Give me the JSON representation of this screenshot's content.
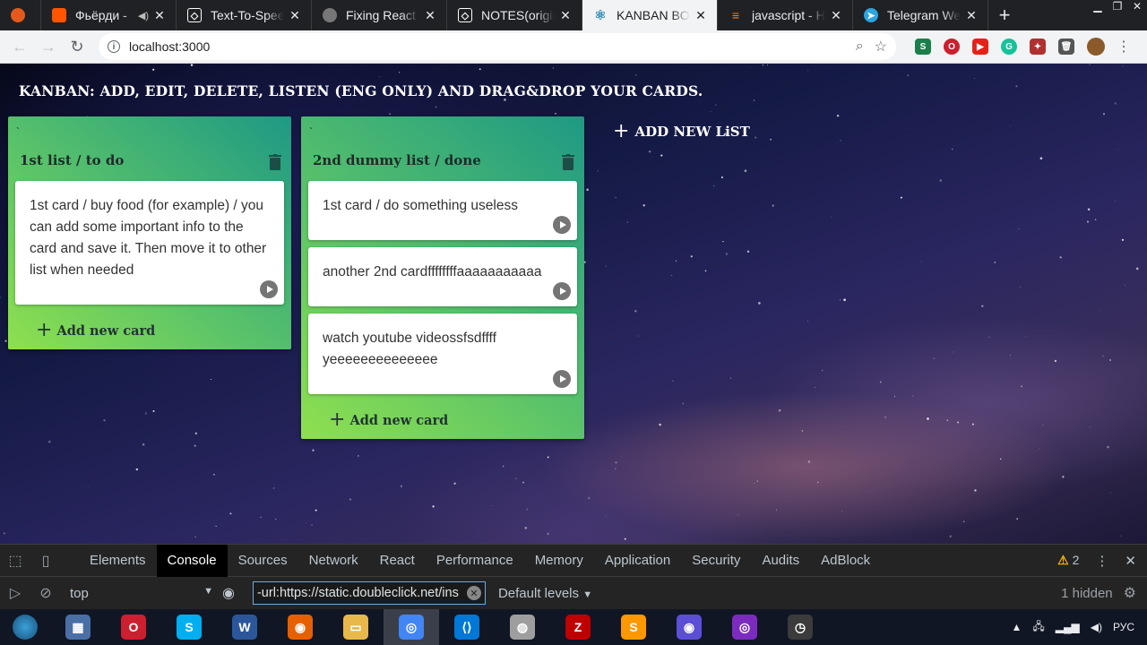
{
  "browser": {
    "tabs": [
      {
        "title": "",
        "icon": "firefox-icon",
        "color": "#e55a1c"
      },
      {
        "title": "Фьёрди - ",
        "icon": "soundcloud-icon",
        "color": "#ff5500",
        "audio": "speaker-icon"
      },
      {
        "title": "Text-To-Speec",
        "icon": "codepen-icon",
        "color": "#444444"
      },
      {
        "title": "Fixing React W",
        "icon": "globe-icon",
        "color": "#777777"
      },
      {
        "title": "NOTES(origina",
        "icon": "codepen-icon",
        "color": "#444444"
      },
      {
        "title": "KANBAN BOA",
        "icon": "react-icon",
        "color": "#3a8fb7",
        "active": true
      },
      {
        "title": "javascript - Ho",
        "icon": "stackoverflow-icon",
        "color": "#f48024"
      },
      {
        "title": "Telegram Web",
        "icon": "telegram-icon",
        "color": "#2ca5e0"
      }
    ],
    "new_tab": "+",
    "url": "localhost:3000"
  },
  "page": {
    "title": "KANBAN: ADD, EDIT, DELETE, LISTEN (ENG ONLY) AND DRAG&DROP YOUR CARDS.",
    "add_list_label": "ADD NEW LiST",
    "add_card_label": "Add new card",
    "lists": [
      {
        "tick": "`",
        "title": "1st list / to do",
        "cards": [
          "1st card / buy food (for example) / you can add some important info to the card and save it. Then move it to other list when needed"
        ]
      },
      {
        "tick": "`",
        "title": "2nd dummy list / done",
        "cards": [
          "1st card / do something useless",
          "another 2nd cardffffffffaaaaaaaaaaa",
          "watch youtube videossfsdffff yeeeeeeeeeeeeee"
        ]
      }
    ]
  },
  "devtools": {
    "tabs": [
      "Elements",
      "Console",
      "Sources",
      "Network",
      "React",
      "Performance",
      "Memory",
      "Application",
      "Security",
      "Audits",
      "AdBlock"
    ],
    "active_tab": "Console",
    "warnings": "2",
    "context": "top",
    "filter_value": "-url:https://static.doubleclick.net/ins",
    "levels": "Default levels",
    "hidden": "1 hidden"
  },
  "taskbar": {
    "apps": [
      {
        "name": "calculator-icon",
        "color": "#4a6fa5"
      },
      {
        "name": "opera-icon",
        "color": "#cc1f2f"
      },
      {
        "name": "skype-icon",
        "color": "#00aff0"
      },
      {
        "name": "word-icon",
        "color": "#2b579a"
      },
      {
        "name": "firefox-icon",
        "color": "#e66000"
      },
      {
        "name": "file-explorer-icon",
        "color": "#e8b84a"
      },
      {
        "name": "chrome-icon",
        "color": "#4285f4",
        "active": true
      },
      {
        "name": "vscode-icon",
        "color": "#0078d7"
      },
      {
        "name": "speaker-app-icon",
        "color": "#9e9e9e"
      },
      {
        "name": "filezilla-icon",
        "color": "#bf0000"
      },
      {
        "name": "sublime-icon",
        "color": "#ff9800"
      },
      {
        "name": "firefox-dev-icon",
        "color": "#5b4fd6"
      },
      {
        "name": "podcast-icon",
        "color": "#7b2cbf"
      },
      {
        "name": "clock-icon",
        "color": "#3b3b3b"
      }
    ],
    "language": "РУС"
  }
}
